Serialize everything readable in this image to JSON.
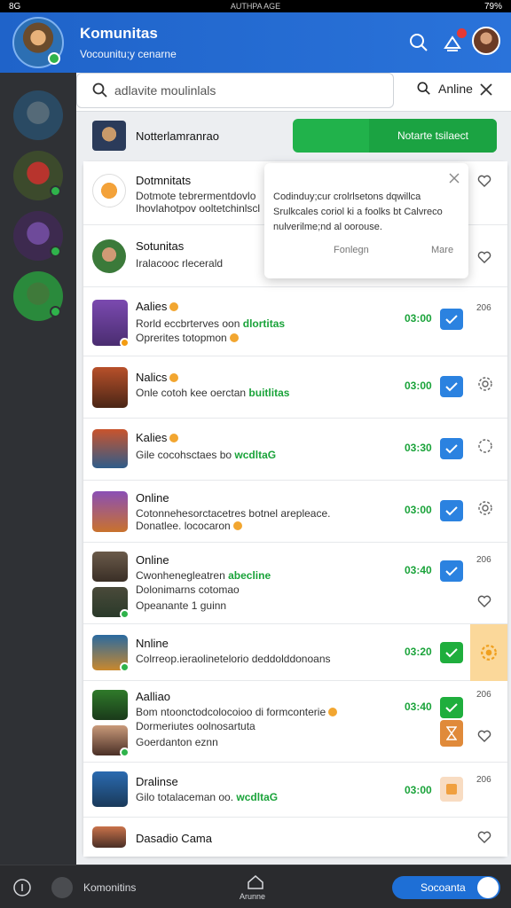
{
  "statusbar": {
    "left": "8G",
    "center": "AUTHPA AGE",
    "right": "79%"
  },
  "header": {
    "title": "Komunitas",
    "subtitle": "Vocounitu;y cenarne"
  },
  "search": {
    "placeholder": "adlavite moulinlals",
    "filter_label": "Anline"
  },
  "top_row": {
    "title": "Notterlamranrao",
    "button_label": "Notarte tsilaect"
  },
  "popup": {
    "text": "Codinduy;cur crolrlsetons dqwillca Srulkcales coriol ki a foolks bt Calvreco nulverilme;nd al oorouse.",
    "btn_left": "Fonlegn",
    "btn_right": "Mare"
  },
  "rows": [
    {
      "name": "Dotmnitats",
      "line1": "Dotmote tebrermentdovlo",
      "line2": "Ihovlahotpov ooltetchinlscl",
      "icon": "heart-icon"
    },
    {
      "name": "Sotunitas",
      "line1": "Iralacooc rlecerald",
      "icon": "heart-icon"
    },
    {
      "name": "Aalies",
      "line1": "Rorld eccbrterves oon",
      "line1_hl": "dlortitas",
      "line2": "Oprerites totopmon",
      "time": "03:00",
      "side": "206",
      "check": "blue"
    },
    {
      "name": "Nalics",
      "line1": "Onle cotoh kee oerctan",
      "line1_hl": "buitlitas",
      "time": "03:00",
      "check": "blue",
      "icon": "gear-icon"
    },
    {
      "name": "Kalies",
      "line1": "Gile cocohsctaes bo",
      "line1_hl": "wcdltaG",
      "time": "03:30",
      "check": "blue",
      "icon": "gear-icon"
    },
    {
      "name": "Online",
      "line1": "Cotonnehesorctacetres botnel arepleace.",
      "line2": "Donatlee. lococaron",
      "time": "03:00",
      "check": "blue",
      "icon": "gear-icon"
    },
    {
      "name": "Online",
      "line1": "Cwonhenegleatren",
      "line1_hl": "abecline",
      "line2": "Dolonimarns cotomao",
      "line3": "Opeanante 1 guinn",
      "time": "03:40",
      "side": "206",
      "check": "blue",
      "icon": "heart-icon"
    },
    {
      "name": "Nnline",
      "line1": "Colrreop.ieraolinetelorio deddolddonoans",
      "time": "03:20",
      "check": "green",
      "icon": "gear-icon"
    },
    {
      "name": "Aalliao",
      "line1": "Bom ntoonctodcolocoioo di formconterie",
      "line2": "Dormeriutes oolnosartuta",
      "line3": "Goerdanton eznn",
      "time": "03:40",
      "side": "206",
      "check": "green",
      "icon": "heart-icon"
    },
    {
      "name": "Dralinse",
      "line1": "Gilo totalaceman oo.",
      "line1_hl": "wcdltaG",
      "time": "03:00",
      "side": "206",
      "check": "pale"
    },
    {
      "name": "Dasadio Cama"
    }
  ],
  "bottom": {
    "community_label": "Komonitins",
    "center_label": "Arunne",
    "toggle_label": "Socoanta"
  },
  "colors": {
    "header_blue": "#1f63c9",
    "green": "#21b24b",
    "check_blue": "#2b82e0"
  }
}
